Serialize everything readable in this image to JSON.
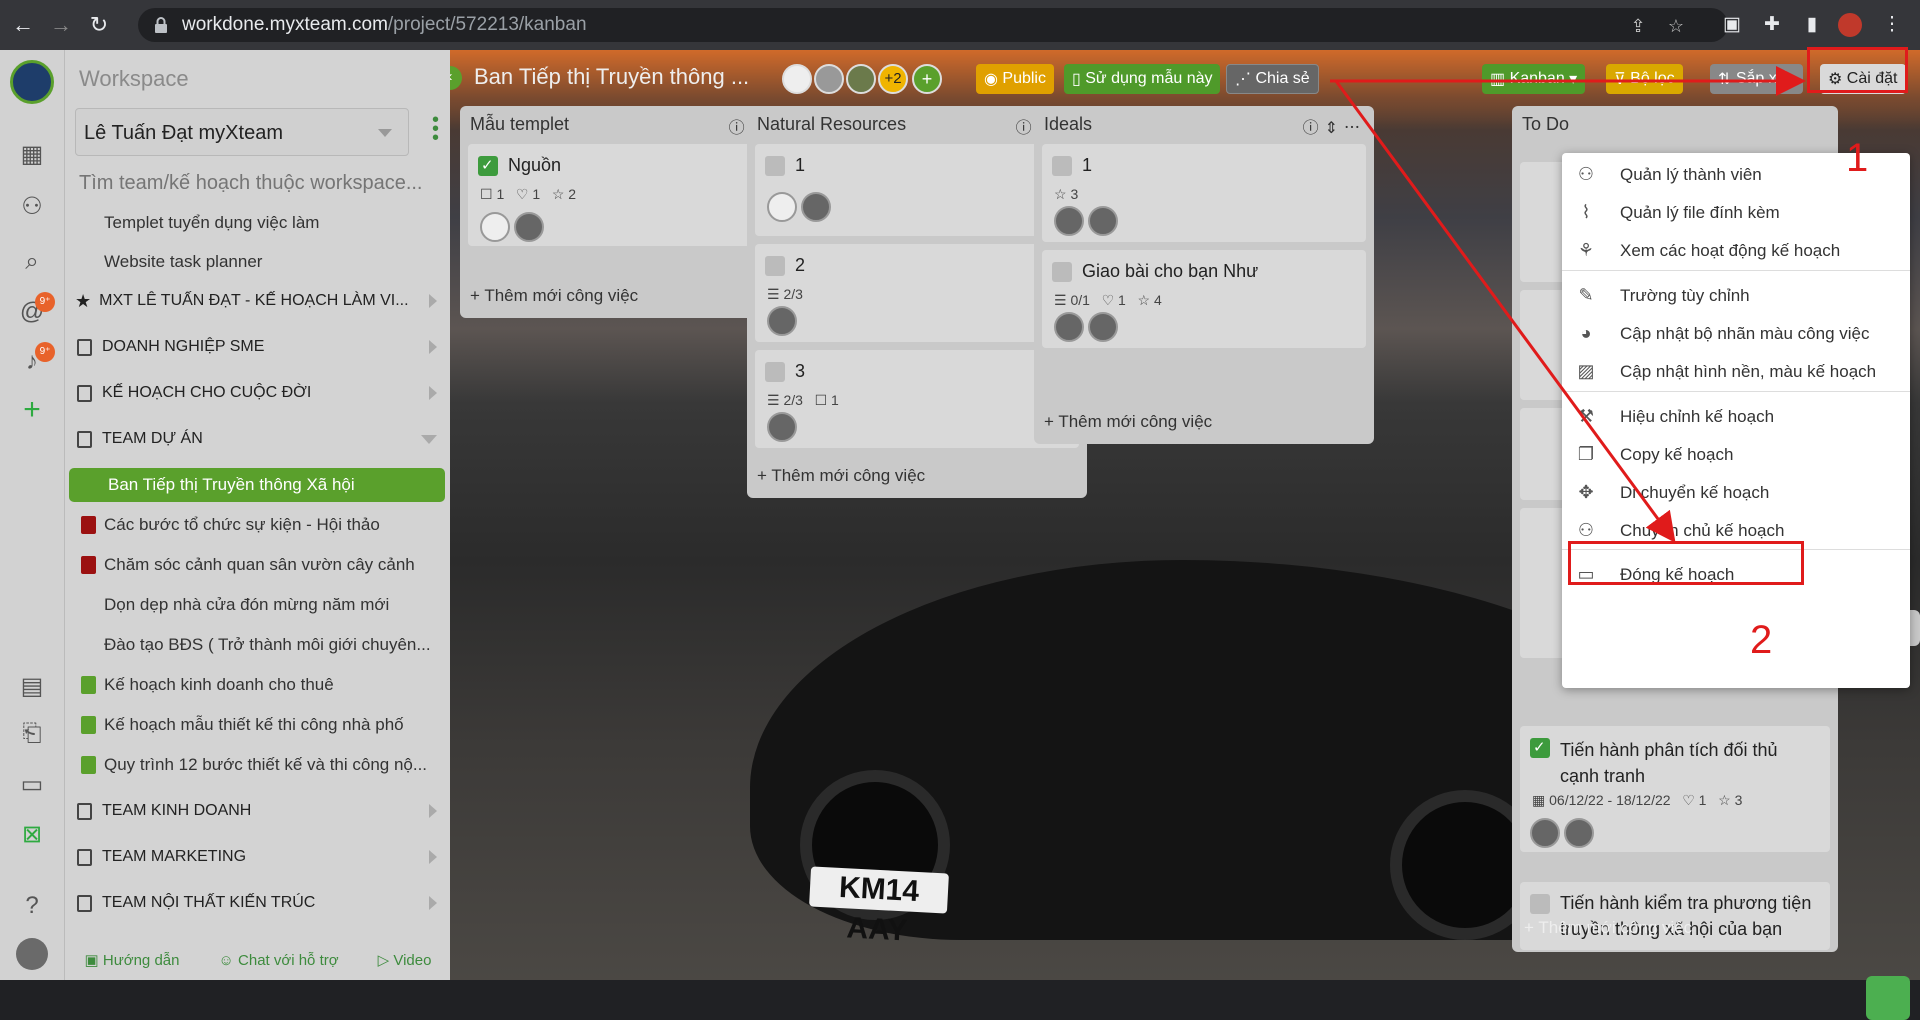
{
  "browser": {
    "url_host": "workdone.myxteam.com",
    "url_path": "/project/572213/kanban"
  },
  "sidebar": {
    "workspace_label": "Workspace",
    "selected_workspace": "Lê Tuấn Đạt myXteam",
    "search_placeholder": "Tìm team/kế hoạch thuộc workspace...",
    "items": [
      {
        "label": "Templet tuyển dụng việc làm",
        "type": "plan"
      },
      {
        "label": "Website task planner",
        "type": "plan"
      },
      {
        "label": "MXT LÊ TUẤN ĐẠT - KẾ HOẠCH LÀM VI...",
        "type": "group-star"
      },
      {
        "label": "DOANH NGHIỆP SME",
        "type": "group"
      },
      {
        "label": "KẾ HOẠCH CHO CUỘC ĐỜI",
        "type": "group"
      },
      {
        "label": "TEAM DỰ ÁN",
        "type": "group-open"
      },
      {
        "label": "Ban Tiếp thị Truyền thông Xã hội",
        "type": "active"
      },
      {
        "label": "Các bước tổ chức sự kiện - Hội thảo",
        "type": "plan",
        "color": "#9b1010"
      },
      {
        "label": "Chăm sóc cảnh quan sân vườn cây cảnh",
        "type": "plan",
        "color": "#9b1010"
      },
      {
        "label": "Dọn dẹp nhà cửa đón mừng năm mới",
        "type": "plan"
      },
      {
        "label": "Đào tạo BĐS ( Trở thành môi giới chuyên...",
        "type": "plan"
      },
      {
        "label": "Kế hoạch kinh doanh cho thuê",
        "type": "plan",
        "color": "#5aa02c"
      },
      {
        "label": "Kế hoạch mẫu thiết kế thi công nhà phố",
        "type": "plan",
        "color": "#5aa02c"
      },
      {
        "label": "Quy trình 12 bước thiết kế và thi công nộ...",
        "type": "plan",
        "color": "#5aa02c"
      },
      {
        "label": "TEAM KINH DOANH",
        "type": "group"
      },
      {
        "label": "TEAM MARKETING",
        "type": "group"
      },
      {
        "label": "TEAM NỘI THẤT KIẾN TRÚC",
        "type": "group"
      }
    ],
    "footer": {
      "guide": "Hướng dẫn",
      "chat": "Chat với hỗ trợ",
      "video": "Video"
    },
    "badges": {
      "mention": "9⁺",
      "notify": "9⁺"
    }
  },
  "header": {
    "title": "Ban Tiếp thị Truyền thông ...",
    "more_members": "+2",
    "public": "Public",
    "use_template": "Sử dụng mẫu này",
    "share": "Chia sẻ",
    "view": "Kanban",
    "filter": "Bộ lọc",
    "sort": "Sắp xếp",
    "settings": "Cài đặt"
  },
  "columns": [
    {
      "title": "Mẫu templet",
      "add": "Thêm mới công việc",
      "cards": [
        {
          "title": "Nguồn",
          "checked": true,
          "meta": [
            "1",
            "1",
            "2"
          ]
        }
      ]
    },
    {
      "title": "Natural Resources",
      "add": "Thêm mới công việc",
      "cards": [
        {
          "title": "1"
        },
        {
          "title": "2",
          "meta": [
            "2/3"
          ]
        },
        {
          "title": "3",
          "meta": [
            "2/3",
            "1"
          ]
        }
      ]
    },
    {
      "title": "Ideals",
      "add": "Thêm mới công việc",
      "cards": [
        {
          "title": "1",
          "meta": [
            "3"
          ]
        },
        {
          "title": "Giao bài cho bạn Như",
          "meta": [
            "0/1",
            "1",
            "4"
          ]
        }
      ]
    },
    {
      "title": "To Do",
      "add": "Thêm mới công việc",
      "cards": [
        {
          "title": "Tiến hành phân tích đối thủ cạnh tranh",
          "checked": true,
          "date": "06/12/22 - 18/12/22",
          "meta": [
            "1",
            "3"
          ]
        },
        {
          "title": "Tiến hành kiểm tra phương tiện truyền thông xã hội của bạn"
        }
      ]
    }
  ],
  "menu": {
    "items": [
      {
        "label": "Quản lý thành viên",
        "icon": "members-icon"
      },
      {
        "label": "Quản lý file đính kèm",
        "icon": "paperclip-icon"
      },
      {
        "label": "Xem các hoạt động kế hoạch",
        "icon": "activity-icon"
      },
      {
        "label": "Trường tùy chỉnh",
        "icon": "edit-icon"
      },
      {
        "label": "Cập nhật bộ nhãn màu công việc",
        "icon": "palette-icon"
      },
      {
        "label": "Cập nhật hình nền, màu kế hoạch",
        "icon": "image-icon"
      },
      {
        "label": "Hiệu chỉnh kế hoạch",
        "icon": "tools-icon"
      },
      {
        "label": "Copy kế hoạch",
        "icon": "copy-icon"
      },
      {
        "label": "Di chuyển kế hoạch",
        "icon": "move-icon"
      },
      {
        "label": "Chuyển chủ kế hoạch",
        "icon": "transfer-owner-icon"
      },
      {
        "label": "Đóng kế hoạch",
        "icon": "archive-icon"
      }
    ]
  },
  "annotations": {
    "step1": "1",
    "step2": "2"
  },
  "background": {
    "plate": "KM14 AAY"
  },
  "colors": {
    "accent": "#5aa02c",
    "annotation": "#e01b1b",
    "badge": "#e8622a",
    "public": "#f0b400"
  }
}
